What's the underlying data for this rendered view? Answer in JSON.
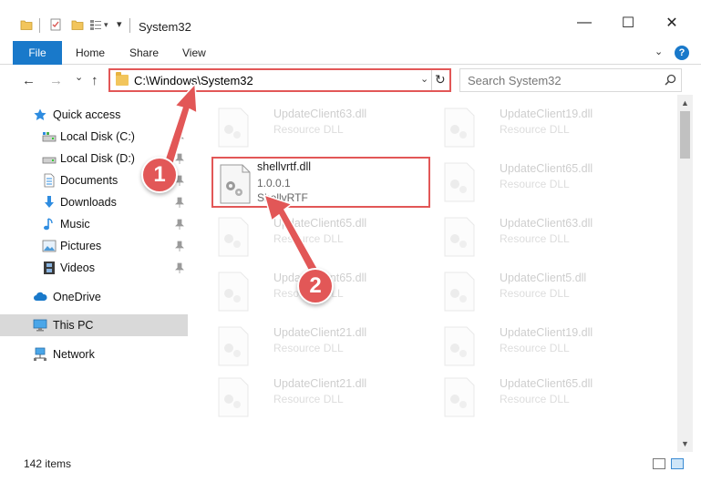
{
  "window": {
    "title": "System32",
    "minimize_glyph": "—",
    "maximize_glyph": "☐",
    "close_glyph": "✕",
    "quick_access_chevron": "▾"
  },
  "ribbon": {
    "tabs": [
      "File",
      "Home",
      "Share",
      "View"
    ],
    "expand_glyph": "⌄",
    "help_glyph": "?"
  },
  "navigation": {
    "back_glyph": "←",
    "forward_glyph": "→",
    "recent_glyph": "⌄",
    "up_glyph": "↑"
  },
  "address": {
    "path": "C:\\Windows\\System32",
    "dropdown_glyph": "⌄",
    "refresh_glyph": "↻"
  },
  "search": {
    "placeholder": "Search System32"
  },
  "sidebar": {
    "items": [
      {
        "label": "Quick access",
        "icon": "star-icon",
        "pinned": false
      },
      {
        "label": "Local Disk (C:)",
        "icon": "drive-icon",
        "pinned": true
      },
      {
        "label": "Local Disk (D:)",
        "icon": "drive-icon",
        "pinned": true
      },
      {
        "label": "Documents",
        "icon": "documents-icon",
        "pinned": true
      },
      {
        "label": "Downloads",
        "icon": "download-icon",
        "pinned": true
      },
      {
        "label": "Music",
        "icon": "music-icon",
        "pinned": true
      },
      {
        "label": "Pictures",
        "icon": "pictures-icon",
        "pinned": true
      },
      {
        "label": "Videos",
        "icon": "videos-icon",
        "pinned": true
      },
      {
        "label": "OneDrive",
        "icon": "cloud-icon",
        "pinned": false
      },
      {
        "label": "This PC",
        "icon": "computer-icon",
        "pinned": false
      },
      {
        "label": "Network",
        "icon": "network-icon",
        "pinned": false
      }
    ]
  },
  "files": {
    "left_column": [
      {
        "name": "UpdateClient63.dll",
        "desc": "Resource DLL"
      },
      {
        "name": "shellvrtf.dll",
        "desc": "1.0.0.1",
        "extra": "ShellvRTF"
      },
      {
        "name": "UpdateClient65.dll",
        "desc": "Resource DLL"
      },
      {
        "name": "UpdateClient65.dll",
        "desc": "Resource DLL"
      },
      {
        "name": "UpdateClient21.dll",
        "desc": "Resource DLL"
      },
      {
        "name": "UpdateClient21.dll",
        "desc": "Resource DLL"
      }
    ],
    "right_column": [
      {
        "name": "UpdateClient19.dll",
        "desc": "Resource DLL"
      },
      {
        "name": "UpdateClient65.dll",
        "desc": "Resource DLL"
      },
      {
        "name": "UpdateClient63.dll",
        "desc": "Resource DLL"
      },
      {
        "name": "UpdateClient5.dll",
        "desc": "Resource DLL"
      },
      {
        "name": "UpdateClient19.dll",
        "desc": "Resource DLL"
      },
      {
        "name": "UpdateClient65.dll",
        "desc": "Resource DLL"
      }
    ]
  },
  "annotations": {
    "step1": "1",
    "step2": "2",
    "color": "#e25757"
  },
  "status": {
    "item_count": "142 items"
  },
  "colors": {
    "accent": "#1979ca",
    "selected_bg": "#cce8ff",
    "this_pc_bg": "#d9d9d9"
  }
}
